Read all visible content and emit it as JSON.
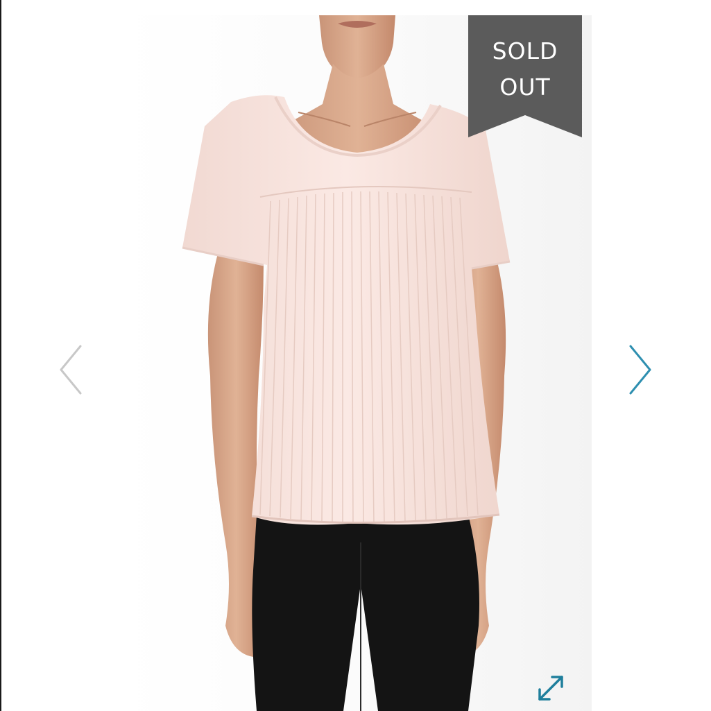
{
  "badge": {
    "line1": "SOLD",
    "line2": "OUT"
  },
  "icons": {
    "prev": "chevron-left-icon",
    "next": "chevron-right-icon",
    "expand": "expand-arrows-icon"
  },
  "colors": {
    "badge_bg": "#5b5b5b",
    "badge_text": "#ffffff",
    "prev_arrow": "#c8c8c8",
    "next_arrow": "#2e8fb0",
    "expand_icon": "#1f7f9c",
    "blouse": "#f8e4de",
    "pants": "#141414",
    "skin": "#d9a98a"
  }
}
